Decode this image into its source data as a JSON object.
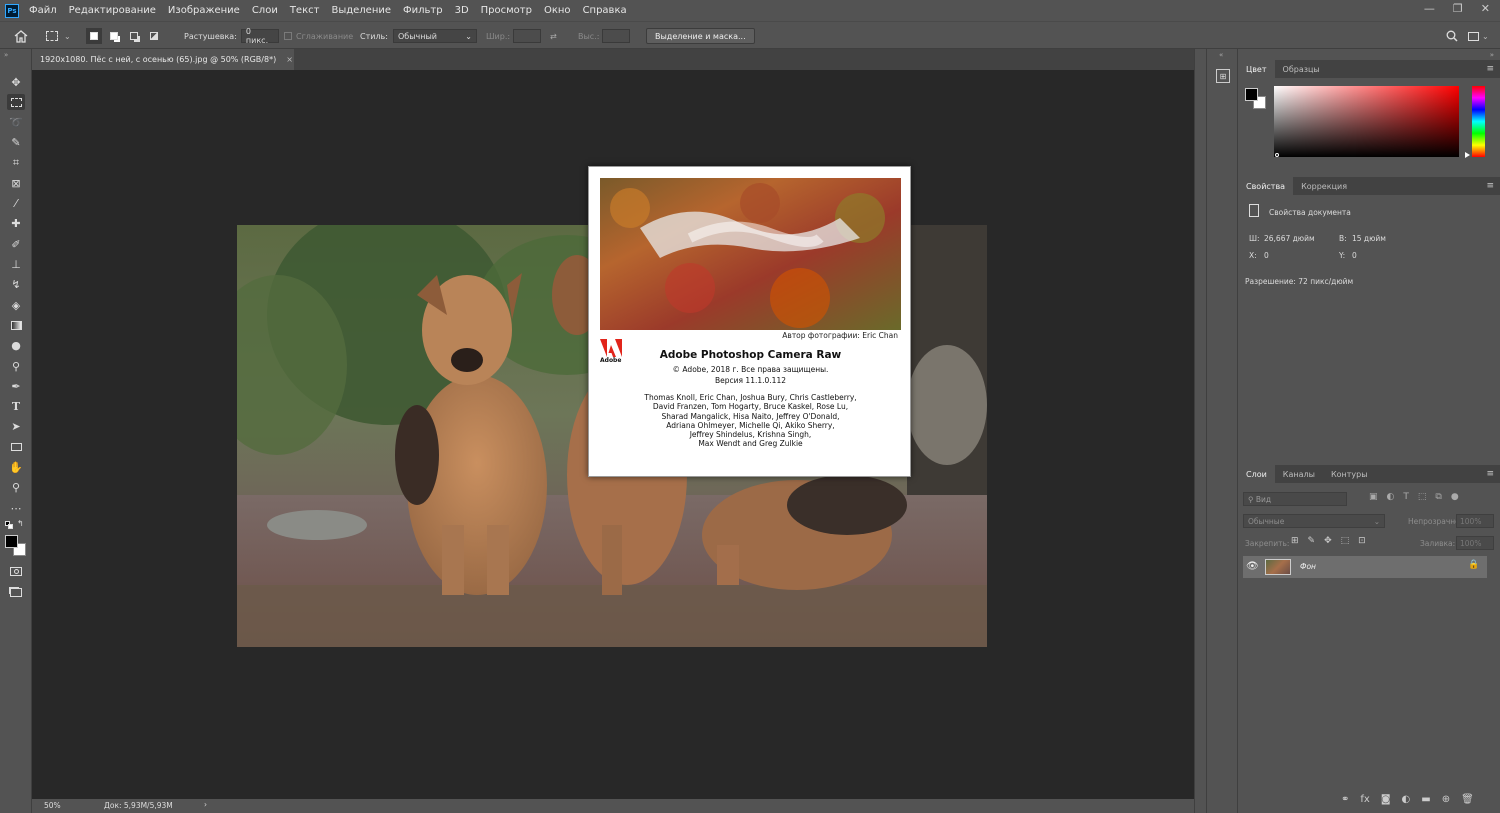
{
  "app": {
    "logo_text": "Ps",
    "menu": [
      "Файл",
      "Редактирование",
      "Изображение",
      "Слои",
      "Текст",
      "Выделение",
      "Фильтр",
      "3D",
      "Просмотр",
      "Окно",
      "Справка"
    ],
    "window_controls": [
      "—",
      "❐",
      "✕"
    ]
  },
  "options": {
    "feather_label": "Растушевка:",
    "feather_value": "0 пикс.",
    "antialias_label": "Сглаживание",
    "style_label": "Стиль:",
    "style_value": "Обычный",
    "width_label": "Шир.:",
    "height_label": "Выс.:",
    "select_mask_button": "Выделение и маска..."
  },
  "document": {
    "tab_title": "1920x1080. Пёс с ней, с осенью (65).jpg @ 50% (RGB/8*)",
    "tab_close": "×"
  },
  "about": {
    "photo_credit": "Автор фотографии: Eric Chan",
    "adobe_word": "Adobe",
    "title": "Adobe Photoshop Camera Raw",
    "copyright": "© Adobe, 2018 г. Все права защищены.",
    "version": "Версия 11.1.0.112",
    "credits": [
      "Thomas Knoll, Eric Chan, Joshua Bury, Chris Castleberry,",
      "David Franzen, Tom Hogarty, Bruce Kaskel, Rose Lu,",
      "Sharad Mangalick, Hisa Naito, Jeffrey O'Donald,",
      "Adriana Ohlmeyer, Michelle Qi, Akiko Sherry,",
      "Jeffrey Shindelus, Krishna Singh,",
      "Max Wendt and Greg Zulkie"
    ]
  },
  "status": {
    "zoom": "50%",
    "doc_size": "Док: 5,93M/5,93M",
    "arrow": "›"
  },
  "color_panel": {
    "tabs": [
      "Цвет",
      "Образцы"
    ],
    "foreground": "#000000",
    "background": "#ffffff",
    "hue_color": "#ff0000"
  },
  "properties_panel": {
    "tabs": [
      "Свойства",
      "Коррекция"
    ],
    "heading": "Свойства документа",
    "w_label": "Ш:",
    "w_value": "26,667 дюйм",
    "h_label": "В:",
    "h_value": "15 дюйм",
    "x_label": "X:",
    "x_value": "0",
    "y_label": "Y:",
    "y_value": "0",
    "resolution": "Разрешение: 72 пикс/дюйм"
  },
  "layers_panel": {
    "tabs": [
      "Слои",
      "Каналы",
      "Контуры"
    ],
    "filter_placeholder": "Вид",
    "blend_mode": "Обычные",
    "opacity_label": "Непрозрачность:",
    "opacity_value": "100%",
    "lock_label": "Закрепить:",
    "fill_label": "Заливка:",
    "fill_value": "100%",
    "layers": [
      {
        "name": "Фон",
        "visible": true,
        "locked": true
      }
    ]
  }
}
